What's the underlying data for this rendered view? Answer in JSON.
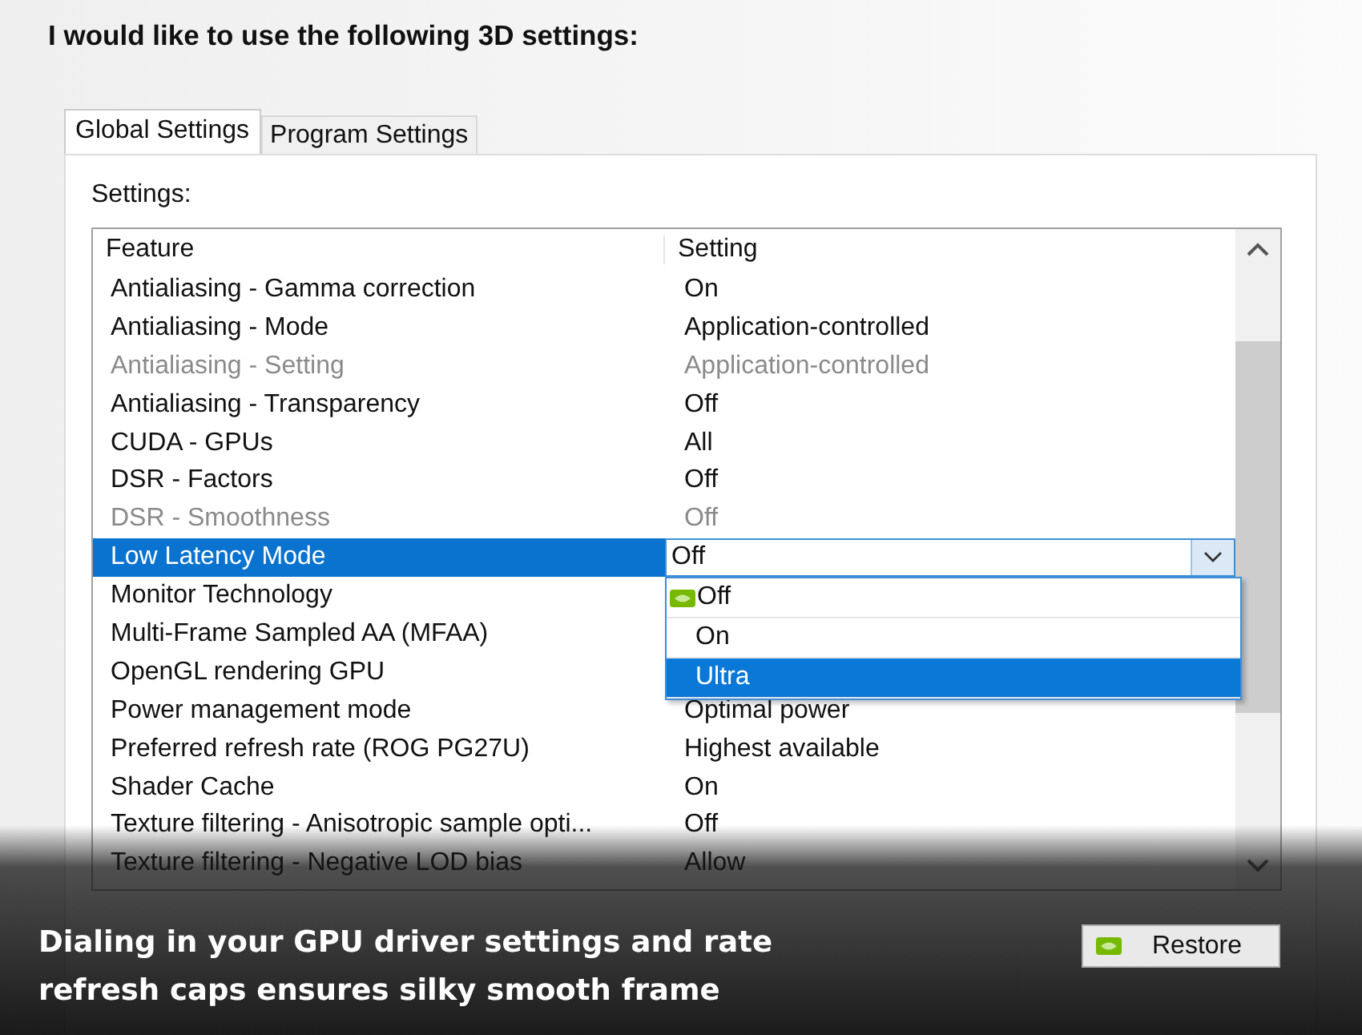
{
  "heading": "I would like to use the following 3D settings:",
  "tabs": [
    {
      "label": "Global Settings",
      "selected": true
    },
    {
      "label": "Program Settings",
      "selected": false
    }
  ],
  "settings_label": "Settings:",
  "table": {
    "columns": [
      "Feature",
      "Setting"
    ],
    "rows": [
      {
        "feature": "Antialiasing - Gamma correction",
        "setting": "On",
        "disabled": false,
        "selected": false
      },
      {
        "feature": "Antialiasing - Mode",
        "setting": "Application-controlled",
        "disabled": false,
        "selected": false
      },
      {
        "feature": "Antialiasing - Setting",
        "setting": "Application-controlled",
        "disabled": true,
        "selected": false
      },
      {
        "feature": "Antialiasing - Transparency",
        "setting": "Off",
        "disabled": false,
        "selected": false
      },
      {
        "feature": "CUDA - GPUs",
        "setting": "All",
        "disabled": false,
        "selected": false
      },
      {
        "feature": "DSR - Factors",
        "setting": "Off",
        "disabled": false,
        "selected": false
      },
      {
        "feature": "DSR - Smoothness",
        "setting": "Off",
        "disabled": true,
        "selected": false
      },
      {
        "feature": "Low Latency Mode",
        "setting": "Off",
        "disabled": false,
        "selected": true
      },
      {
        "feature": "Monitor Technology",
        "disabled": false,
        "selected": false
      },
      {
        "feature": "Multi-Frame Sampled AA (MFAA)",
        "disabled": false,
        "selected": false
      },
      {
        "feature": "OpenGL rendering GPU",
        "disabled": false,
        "selected": false
      },
      {
        "feature": "Power management mode",
        "setting": "Optimal power",
        "disabled": false,
        "selected": false
      },
      {
        "feature": "Preferred refresh rate (ROG PG27U)",
        "setting": "Highest available",
        "disabled": false,
        "selected": false
      },
      {
        "feature": "Shader Cache",
        "setting": "On",
        "disabled": false,
        "selected": false
      },
      {
        "feature": "Texture filtering - Anisotropic sample opti...",
        "setting": "Off",
        "disabled": false,
        "selected": false
      },
      {
        "feature": "Texture filtering - Negative LOD bias",
        "setting": "Allow",
        "disabled": false,
        "selected": false
      }
    ]
  },
  "dropdown": {
    "options": [
      {
        "label": "Off",
        "selected": false,
        "icon": true
      },
      {
        "label": "On",
        "selected": false,
        "icon": false
      },
      {
        "label": "Ultra",
        "selected": true,
        "icon": false
      }
    ]
  },
  "restore_button": "Restore",
  "caption": "Dialing in your GPU driver settings and rate refresh caps ensures silky smooth frame"
}
